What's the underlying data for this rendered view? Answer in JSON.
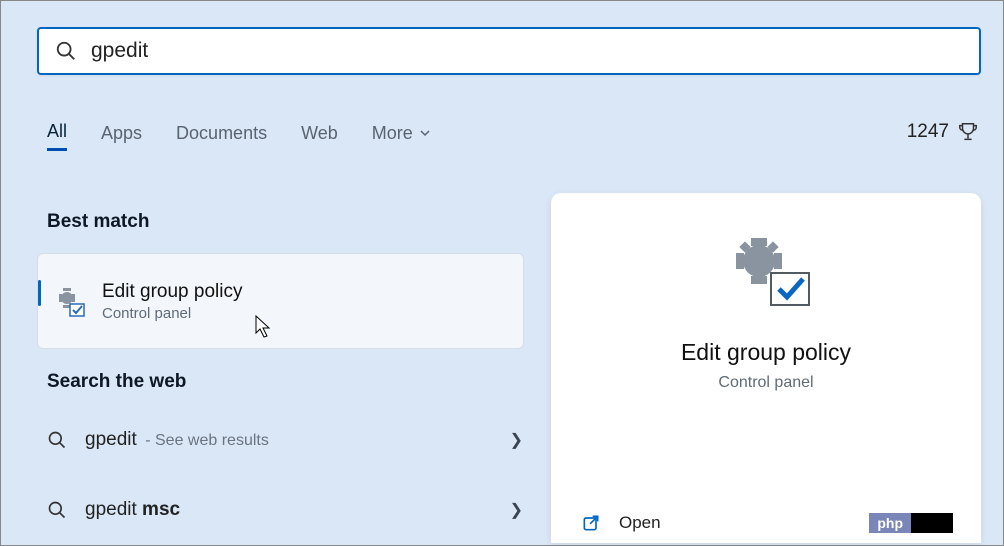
{
  "search": {
    "value": "gpedit"
  },
  "tabs": {
    "items": [
      {
        "label": "All",
        "active": true
      },
      {
        "label": "Apps"
      },
      {
        "label": "Documents"
      },
      {
        "label": "Web"
      },
      {
        "label": "More"
      }
    ]
  },
  "rewards": {
    "points": "1247"
  },
  "sections": {
    "best_match_label": "Best match",
    "search_web_label": "Search the web"
  },
  "best_match": {
    "title": "Edit group policy",
    "subtitle": "Control panel"
  },
  "web_results": [
    {
      "query": "gpedit",
      "suffix": " - See web results"
    },
    {
      "prefix": "gpedit ",
      "bold": "msc"
    }
  ],
  "preview": {
    "title": "Edit group policy",
    "subtitle": "Control panel",
    "open": "Open"
  },
  "badge": {
    "php": "php"
  }
}
